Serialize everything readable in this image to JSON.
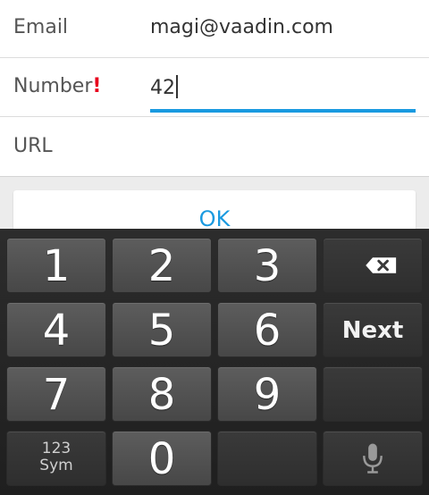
{
  "form": {
    "email": {
      "label": "Email",
      "value": "magi@vaadin.com"
    },
    "number": {
      "label": "Number",
      "required_marker": "!",
      "value": "42"
    },
    "url": {
      "label": "URL",
      "value": ""
    }
  },
  "ok_button": {
    "label": "OK"
  },
  "keyboard": {
    "keys": {
      "k1": "1",
      "k2": "2",
      "k3": "3",
      "k4": "4",
      "k5": "5",
      "k6": "6",
      "k7": "7",
      "k8": "8",
      "k9": "9",
      "k0": "0",
      "next": "Next",
      "sym_line1": "123",
      "sym_line2": "Sym"
    },
    "icons": {
      "backspace": "backspace-icon",
      "mic": "microphone-icon"
    }
  },
  "colors": {
    "accent": "#1a9ae0",
    "required": "#e8001c",
    "keyboard_bg": "#222222",
    "key_bg": "#505050"
  }
}
